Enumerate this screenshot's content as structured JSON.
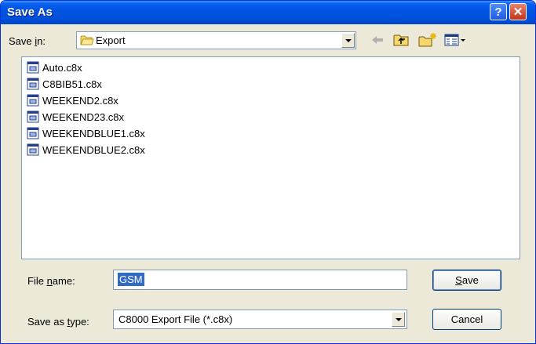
{
  "dialog": {
    "title": "Save As",
    "help_glyph": "?",
    "close_glyph": "✕"
  },
  "save_in": {
    "label_pre": "Save ",
    "label_key": "i",
    "label_post": "n:",
    "value": "Export",
    "icon": "folder-icon"
  },
  "toolbar": {
    "back_icon": "back-arrow-icon",
    "up_icon": "up-one-level-icon",
    "new_folder_icon": "new-folder-icon",
    "views_icon": "views-menu-icon"
  },
  "files": [
    {
      "name": "Auto.c8x"
    },
    {
      "name": "C8BIB51.c8x"
    },
    {
      "name": "WEEKEND2.c8x"
    },
    {
      "name": "WEEKEND23.c8x"
    },
    {
      "name": "WEEKENDBLUE1.c8x"
    },
    {
      "name": "WEEKENDBLUE2.c8x"
    }
  ],
  "file_name": {
    "label_pre": "File ",
    "label_key": "n",
    "label_post": "ame:",
    "value": "GSM"
  },
  "save_type": {
    "label_pre": "Save as ",
    "label_key": "t",
    "label_post": "ype:",
    "value": "C8000 Export File (*.c8x)"
  },
  "buttons": {
    "save_key": "S",
    "save_rest": "ave",
    "cancel": "Cancel"
  },
  "colors": {
    "title_bar": "#0054e3",
    "face": "#ece9d8",
    "selection": "#316ac5"
  }
}
